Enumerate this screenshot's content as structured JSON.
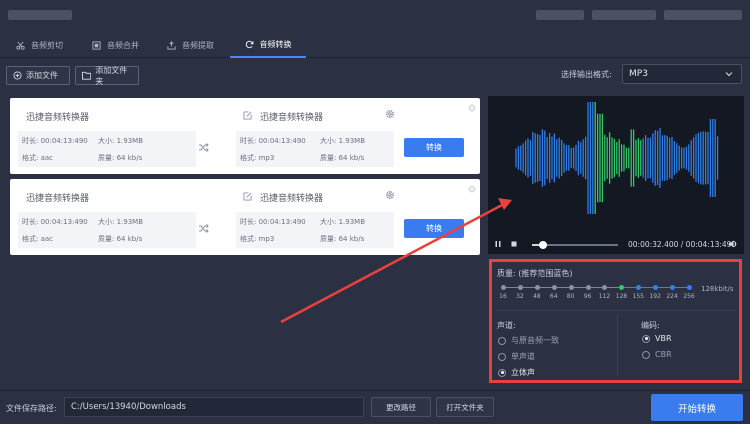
{
  "tabs": [
    {
      "label": "音频剪切",
      "icon": "scissors-icon"
    },
    {
      "label": "音频合并",
      "icon": "merge-icon"
    },
    {
      "label": "音频提取",
      "icon": "extract-icon"
    },
    {
      "label": "音频转换",
      "icon": "convert-icon",
      "active": true
    }
  ],
  "toolbar": {
    "add_file": "添加文件",
    "add_folder": "添加文件夹",
    "format_label": "选择输出格式:",
    "format_value": "MP3"
  },
  "files": [
    {
      "src_name": "迅捷音频转换器",
      "src_duration": "时长: 00:04:13:490",
      "src_size": "大小: 1.93MB",
      "src_format": "格式: aac",
      "src_quality": "质量: 64 kb/s",
      "dst_name": "迅捷音频转换器",
      "dst_duration": "时长: 00:04:13:490",
      "dst_size": "大小: 1.93MB",
      "dst_format": "格式: mp3",
      "dst_quality": "质量: 64 kb/s",
      "convert_label": "转换"
    },
    {
      "src_name": "迅捷音频转换器",
      "src_duration": "时长: 00:04:13:490",
      "src_size": "大小: 1.93MB",
      "src_format": "格式: aac",
      "src_quality": "质量: 64 kb/s",
      "dst_name": "迅捷音频转换器",
      "dst_duration": "时长: 00:04:13:490",
      "dst_size": "大小: 1.93MB",
      "dst_format": "格式: mp3",
      "dst_quality": "质量: 64 kb/s",
      "convert_label": "转换"
    }
  ],
  "player": {
    "time": "00:00:32.400 / 00:04:13:490",
    "progress": 0.13
  },
  "quality": {
    "title": "质量: (推荐范围蓝色)",
    "ticks": [
      "16",
      "32",
      "48",
      "64",
      "80",
      "96",
      "112",
      "128",
      "155",
      "192",
      "224",
      "256"
    ],
    "selected_index": 7,
    "value": "128kbit/s"
  },
  "channel": {
    "title": "声道:",
    "options": [
      "与原音频一致",
      "单声道",
      "立体声"
    ],
    "selected": 2
  },
  "encoding": {
    "title": "编码:",
    "options": [
      "VBR",
      "CBR"
    ],
    "selected": 0
  },
  "bottom": {
    "path_label": "文件保存路径:",
    "path_value": "C:/Users/13940/Downloads",
    "change_path": "更改路径",
    "open_folder": "打开文件夹",
    "start": "开始转换"
  },
  "colors": {
    "accent": "#3a7cf0",
    "highlight": "#e8413f",
    "wave_blue": "#2f7fe8",
    "wave_green": "#35c86a"
  }
}
